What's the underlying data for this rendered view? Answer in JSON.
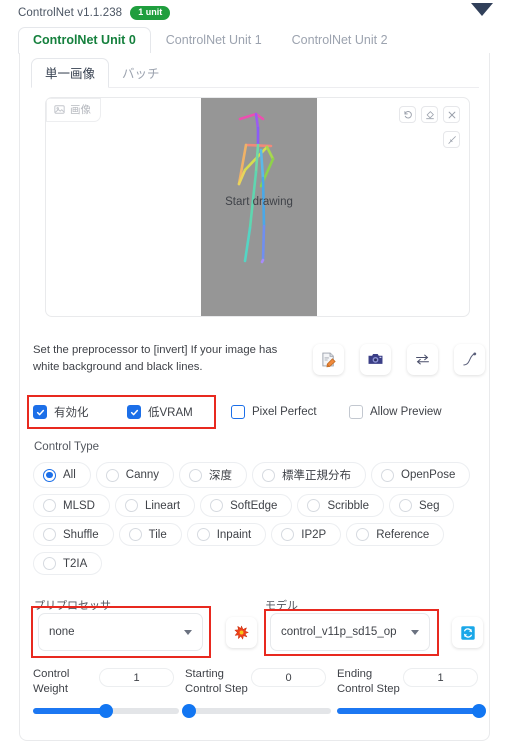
{
  "header": {
    "title": "ControlNet v1.1.238",
    "badge": "1 unit",
    "collapse_icon": "triangle-down-icon"
  },
  "unit_tabs": [
    {
      "label": "ControlNet Unit 0",
      "active": true
    },
    {
      "label": "ControlNet Unit 1",
      "active": false
    },
    {
      "label": "ControlNet Unit 2",
      "active": false
    }
  ],
  "inner_tabs": [
    {
      "label": "単一画像",
      "active": true
    },
    {
      "label": "バッチ",
      "active": false
    }
  ],
  "image_area": {
    "chip_label": "画像",
    "canvas_label": "Start drawing",
    "canvas_bg": "#969696",
    "tools": [
      {
        "name": "undo-icon"
      },
      {
        "name": "eraser-icon"
      },
      {
        "name": "close-icon"
      },
      {
        "name": "brush-icon"
      }
    ],
    "skeleton_colors": [
      "#e86aa8",
      "#8b5cf6",
      "#f0a868",
      "#cdd447",
      "#8ed24a",
      "#5fd6b0",
      "#4aa8e8",
      "#a78bfa"
    ]
  },
  "hint": {
    "line1": "Set the preprocessor to [invert] If your image has",
    "line2": "white background and black lines."
  },
  "action_icons": [
    {
      "name": "edit-note-icon",
      "glyph": "📝"
    },
    {
      "name": "camera-icon",
      "glyph": "📷"
    },
    {
      "name": "swap-arrows-icon",
      "glyph": "⇄"
    },
    {
      "name": "curve-icon",
      "glyph": "⌒"
    }
  ],
  "checkboxes": [
    {
      "label": "有効化",
      "checked": true,
      "style": "filled"
    },
    {
      "label": "低VRAM",
      "checked": true,
      "style": "filled"
    },
    {
      "label": "Pixel Perfect",
      "checked": false,
      "style": "blue-outline"
    },
    {
      "label": "Allow Preview",
      "checked": false,
      "style": "grey-outline"
    }
  ],
  "control_type": {
    "title": "Control Type",
    "options": [
      {
        "label": "All",
        "selected": true
      },
      {
        "label": "Canny",
        "selected": false
      },
      {
        "label": "深度",
        "selected": false
      },
      {
        "label": "標準正規分布",
        "selected": false
      },
      {
        "label": "OpenPose",
        "selected": false
      },
      {
        "label": "MLSD",
        "selected": false
      },
      {
        "label": "Lineart",
        "selected": false
      },
      {
        "label": "SoftEdge",
        "selected": false
      },
      {
        "label": "Scribble",
        "selected": false
      },
      {
        "label": "Seg",
        "selected": false
      },
      {
        "label": "Shuffle",
        "selected": false
      },
      {
        "label": "Tile",
        "selected": false
      },
      {
        "label": "Inpaint",
        "selected": false
      },
      {
        "label": "IP2P",
        "selected": false
      },
      {
        "label": "Reference",
        "selected": false
      },
      {
        "label": "T2IA",
        "selected": false
      }
    ]
  },
  "preprocessor": {
    "label": "プリプロセッサ",
    "value": "none",
    "run_icon": "explosion-icon",
    "run_glyph": "✳"
  },
  "model": {
    "label": "モデル",
    "value": "control_v11p_sd15_op",
    "refresh_icon": "refresh-icon",
    "refresh_glyph": "🔄"
  },
  "sliders": [
    {
      "name_l1": "Control",
      "name_l2": "Weight",
      "value": "1",
      "percent": 50
    },
    {
      "name_l1": "Starting",
      "name_l2": "Control Step",
      "value": "0",
      "percent": 0
    },
    {
      "name_l1": "Ending",
      "name_l2": "Control Step",
      "value": "1",
      "percent": 100
    }
  ],
  "highlight_color": "#e8291f"
}
